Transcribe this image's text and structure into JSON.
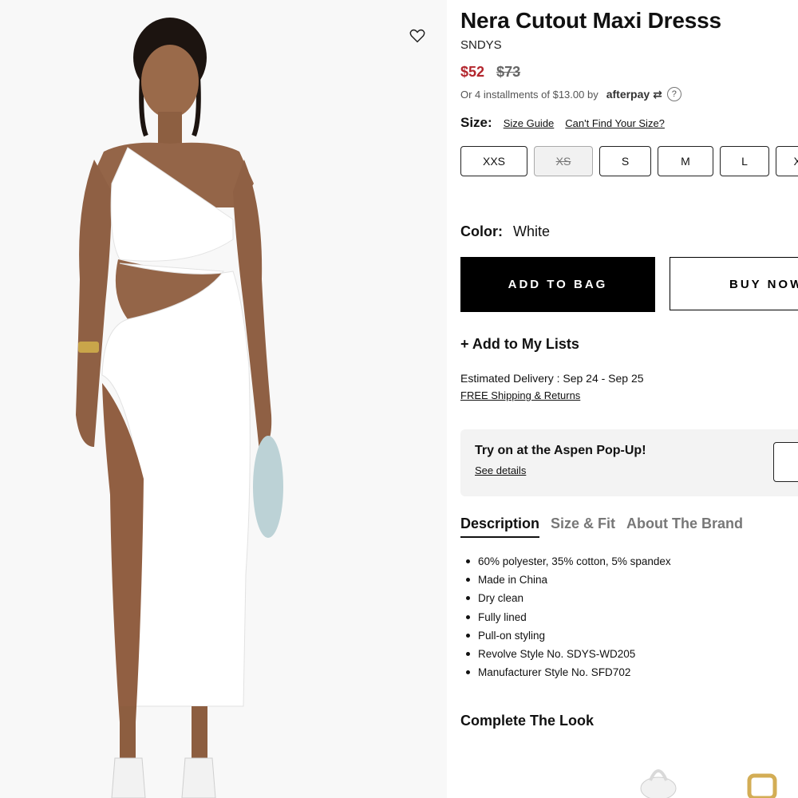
{
  "product": {
    "title": "Nera Cutout Maxi Dresss",
    "brand": "SNDYS",
    "price_sale": "$52",
    "price_original": "$73",
    "installments_text": "Or 4 installments of $13.00 by",
    "installments_provider": "afterpay",
    "help_glyph": "?"
  },
  "size": {
    "label": "Size:",
    "guide_link": "Size Guide",
    "cant_find_link": "Can't Find Your Size?",
    "options": [
      {
        "label": "XXS",
        "available": true
      },
      {
        "label": "XS",
        "available": false
      },
      {
        "label": "S",
        "available": true
      },
      {
        "label": "M",
        "available": true
      },
      {
        "label": "L",
        "available": true
      },
      {
        "label": "XL",
        "available": true
      }
    ]
  },
  "color": {
    "label": "Color:",
    "value": "White"
  },
  "actions": {
    "add_to_bag": "ADD TO BAG",
    "buy_now": "BUY NOW",
    "add_to_lists": "+ Add to My Lists"
  },
  "delivery": {
    "estimate": "Estimated Delivery : Sep 24 - Sep 25",
    "shipping_link": "FREE Shipping & Returns"
  },
  "popup": {
    "title": "Try on at the Aspen Pop-Up!",
    "link": "See details"
  },
  "tabs": [
    {
      "label": "Description",
      "active": true
    },
    {
      "label": "Size & Fit",
      "active": false
    },
    {
      "label": "About The Brand",
      "active": false
    }
  ],
  "description": [
    "60% polyester, 35% cotton, 5% spandex",
    "Made in China",
    "Dry clean",
    "Fully lined",
    "Pull-on styling",
    "Revolve Style No. SDYS-WD205",
    "Manufacturer Style No. SFD702"
  ],
  "complete_look": {
    "title": "Complete The Look"
  },
  "icons": {
    "wishlist": "heart-outline-icon"
  },
  "colors": {
    "sale_price": "#b3262d",
    "primary_button": "#000000",
    "popup_bg": "#f3f3f3"
  }
}
